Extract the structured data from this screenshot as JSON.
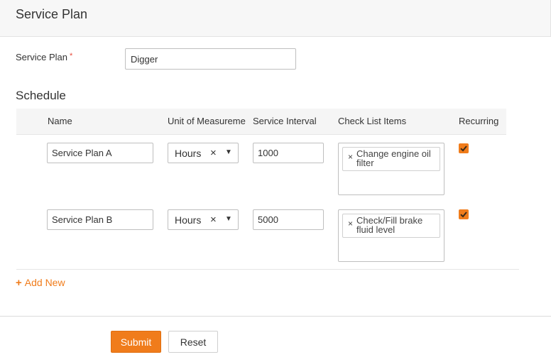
{
  "header": {
    "title": "Service Plan"
  },
  "form": {
    "service_plan_label": "Service Plan",
    "required_marker": "*",
    "service_plan_value": "Digger"
  },
  "schedule": {
    "title": "Schedule",
    "columns": {
      "name": "Name",
      "unit": "Unit of Measureme",
      "interval": "Service Interval",
      "checklist": "Check List Items",
      "recurring": "Recurring"
    },
    "rows": [
      {
        "name": "Service Plan A",
        "unit": "Hours",
        "interval": "1000",
        "checklist_item": "Change engine oil filter",
        "recurring": true
      },
      {
        "name": "Service Plan B",
        "unit": "Hours",
        "interval": "5000",
        "checklist_item": "Check/Fill brake fluid level",
        "recurring": true
      }
    ],
    "icons": {
      "clear": "×",
      "caret": "▼",
      "chip_remove": "×",
      "add": "+"
    },
    "add_new_label": "Add New"
  },
  "actions": {
    "submit_label": "Submit",
    "reset_label": "Reset"
  },
  "colors": {
    "accent": "#f07c1b",
    "required": "#e74c3c"
  }
}
